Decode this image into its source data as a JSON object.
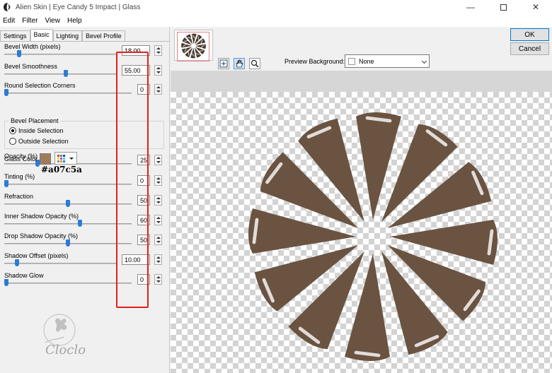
{
  "title_bar": {
    "title": "Alien Skin | Eye Candy 5 Impact | Glass"
  },
  "menu": [
    "Edit",
    "Filter",
    "View",
    "Help"
  ],
  "tabs": [
    "Settings",
    "Basic",
    "Lighting",
    "Bevel Profile"
  ],
  "active_tab": "Basic",
  "params": [
    {
      "label": "Bevel Width (pixels)",
      "value": "18.00",
      "level": 0.12
    },
    {
      "label": "Bevel Smoothness",
      "value": "55.00",
      "level": 0.55
    },
    {
      "label": "Round Selection Corners",
      "value": "0",
      "level": 0.0
    },
    {
      "label": "Opacity (%)",
      "value": "25",
      "level": 0.25
    },
    {
      "label": "Tinting (%)",
      "value": "0",
      "level": 0.0
    },
    {
      "label": "Refraction",
      "value": "50",
      "level": 0.5
    },
    {
      "label": "Inner Shadow Opacity (%)",
      "value": "60",
      "level": 0.6
    },
    {
      "label": "Drop Shadow Opacity (%)",
      "value": "50",
      "level": 0.5
    },
    {
      "label": "Shadow Offset (pixels)",
      "value": "10.00",
      "level": 0.1
    },
    {
      "label": "Shadow Glow",
      "value": "0",
      "level": 0.0
    }
  ],
  "bevel_placement": {
    "legend": "Bevel Placement",
    "options": [
      "Inside Selection",
      "Outside Selection"
    ],
    "selected": "Inside Selection"
  },
  "glass_color": {
    "label": "Glass Color",
    "value": "#a07c5a",
    "annotation": "#a07c5a"
  },
  "preview_background": {
    "label": "Preview Background:",
    "value": "None"
  },
  "buttons": {
    "ok": "OK",
    "cancel": "Cancel"
  },
  "watermark": "Cloclo",
  "colors": {
    "shape": "#6b5341",
    "highlight": "#ffffff",
    "annotation_box": "#e02020",
    "thumb": "#2b7bd6"
  },
  "icons": [
    "app-icon",
    "navigate-icon",
    "hand-icon",
    "zoom-icon",
    "minimize-icon",
    "maximize-icon",
    "close-icon"
  ]
}
